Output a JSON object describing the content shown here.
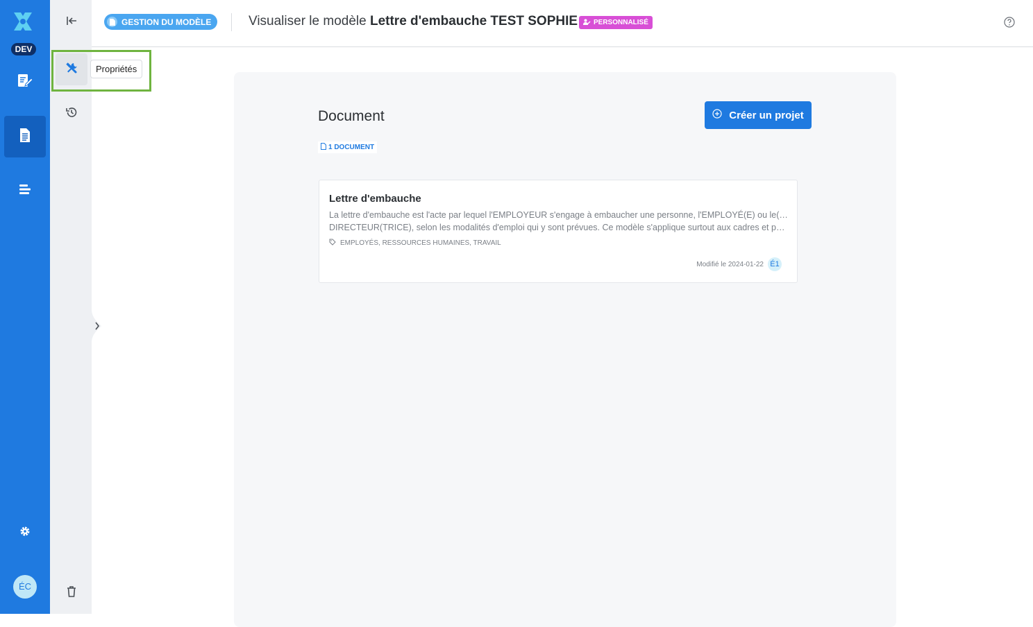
{
  "rail": {
    "env_badge": "DEV",
    "nav": [
      {
        "name": "edit-document-icon"
      },
      {
        "name": "document-icon",
        "active": true
      },
      {
        "name": "list-icon"
      }
    ],
    "settings_icon": "gear-icon",
    "avatar_initials": "ÉC"
  },
  "toolbar": {
    "collapse_icon": "arrow-left-to-line-icon",
    "properties_icon": "tools-icon",
    "properties_tooltip": "Propriétés",
    "history_icon": "history-icon",
    "trash_icon": "trash-icon"
  },
  "header": {
    "section_badge": "GESTION DU MODÈLE",
    "title_prefix": "Visualiser le modèle",
    "title_name": "Lettre d'embauche TEST SOPHIE",
    "custom_badge": "PERSONNALISÉ",
    "help_icon": "question-circle-icon"
  },
  "main": {
    "heading": "Document",
    "create_button": "Créer un projet",
    "doc_count": "1 DOCUMENT",
    "card": {
      "title": "Lettre d'embauche",
      "desc_line1": "La lettre d'embauche est l'acte par lequel l'EMPLOYEUR s'engage à embaucher une personne, l'EMPLOYÉ(E) ou le(la)",
      "desc_line2": "DIRECTEUR(TRICE), selon les modalités d'emploi qui y sont prévues. Ce modèle s'applique surtout aux cadres et peut être",
      "tags": "EMPLOYÉS, RESSOURCES HUMAINES, TRAVAIL",
      "modified": "Modifié le 2024-01-22",
      "user_initials": "É1"
    }
  },
  "colors": {
    "primary": "#1f7ae0",
    "rail_active": "#1360be",
    "custom_badge": "#d84fd6",
    "highlight": "#6fb43f"
  }
}
